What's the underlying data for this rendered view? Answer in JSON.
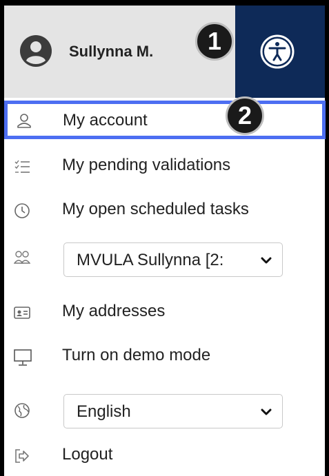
{
  "header": {
    "user_name": "Sullynna M.",
    "badge_1": "1",
    "badge_2": "2",
    "colors": {
      "user_bg": "#e4e4e4",
      "accessibility_bg": "#0e2a58",
      "highlight": "#4d6ef2"
    }
  },
  "menu": {
    "my_account": "My account",
    "pending_validations": "My pending validations",
    "open_tasks": "My open scheduled tasks",
    "profile_select": "MVULA Sullynna [2:",
    "my_addresses": "My addresses",
    "demo_mode": "Turn on demo mode",
    "language_select": "English",
    "logout": "Logout"
  },
  "icons": [
    "user-icon",
    "accessibility-icon",
    "list-check-icon",
    "clock-icon",
    "users-icon",
    "id-card-icon",
    "monitor-icon",
    "globe-icon",
    "logout-icon",
    "chevron-down-icon"
  ]
}
